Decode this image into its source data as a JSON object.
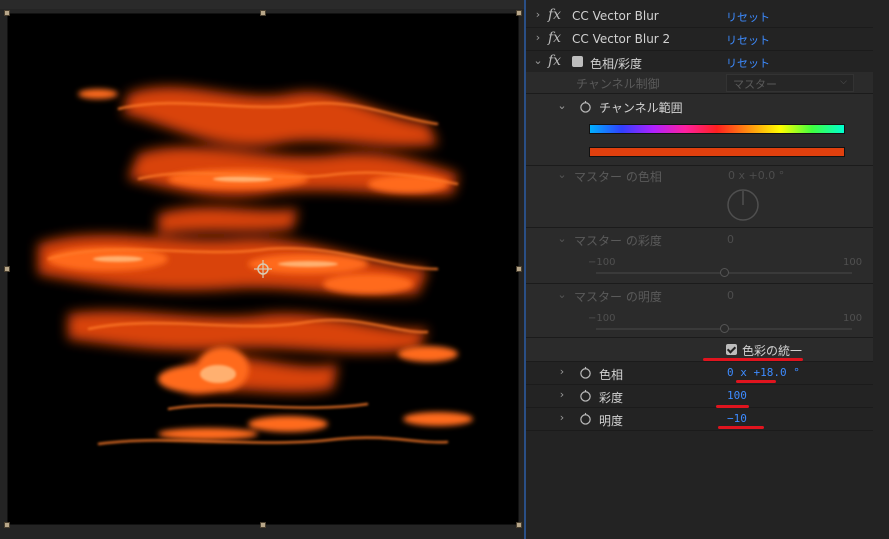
{
  "effects": [
    {
      "name": "CC Vector Blur",
      "reset": "リセット",
      "expanded": false
    },
    {
      "name": "CC Vector Blur 2",
      "reset": "リセット",
      "expanded": false
    },
    {
      "name": "色相/彩度",
      "reset": "リセット",
      "expanded": true
    }
  ],
  "hue_saturation": {
    "channel_control": {
      "label": "チャンネル制御",
      "value": "マスター"
    },
    "channel_range": {
      "label": "チャンネル範囲"
    },
    "master_hue": {
      "label": "マスター の色相",
      "value": "0 x +0.0 °"
    },
    "master_saturation": {
      "label": "マスター の彩度",
      "value": "0",
      "min": "−100",
      "max": "100",
      "level": 0
    },
    "master_lightness": {
      "label": "マスター の明度",
      "value": "0",
      "min": "−100",
      "max": "100",
      "level": 0
    },
    "colorize": {
      "label": "色彩の統一",
      "checked": true
    },
    "colorize_hue": {
      "label": "色相",
      "value": "0 x +18.0 °"
    },
    "colorize_saturation": {
      "label": "彩度",
      "value": "100"
    },
    "colorize_lightness": {
      "label": "明度",
      "value": "−10"
    }
  },
  "colors": {
    "accent_blue": "#3d8bff",
    "annotation_red": "#e0141e",
    "range_bar": "#e0400e",
    "glow": "#ff5a10"
  }
}
